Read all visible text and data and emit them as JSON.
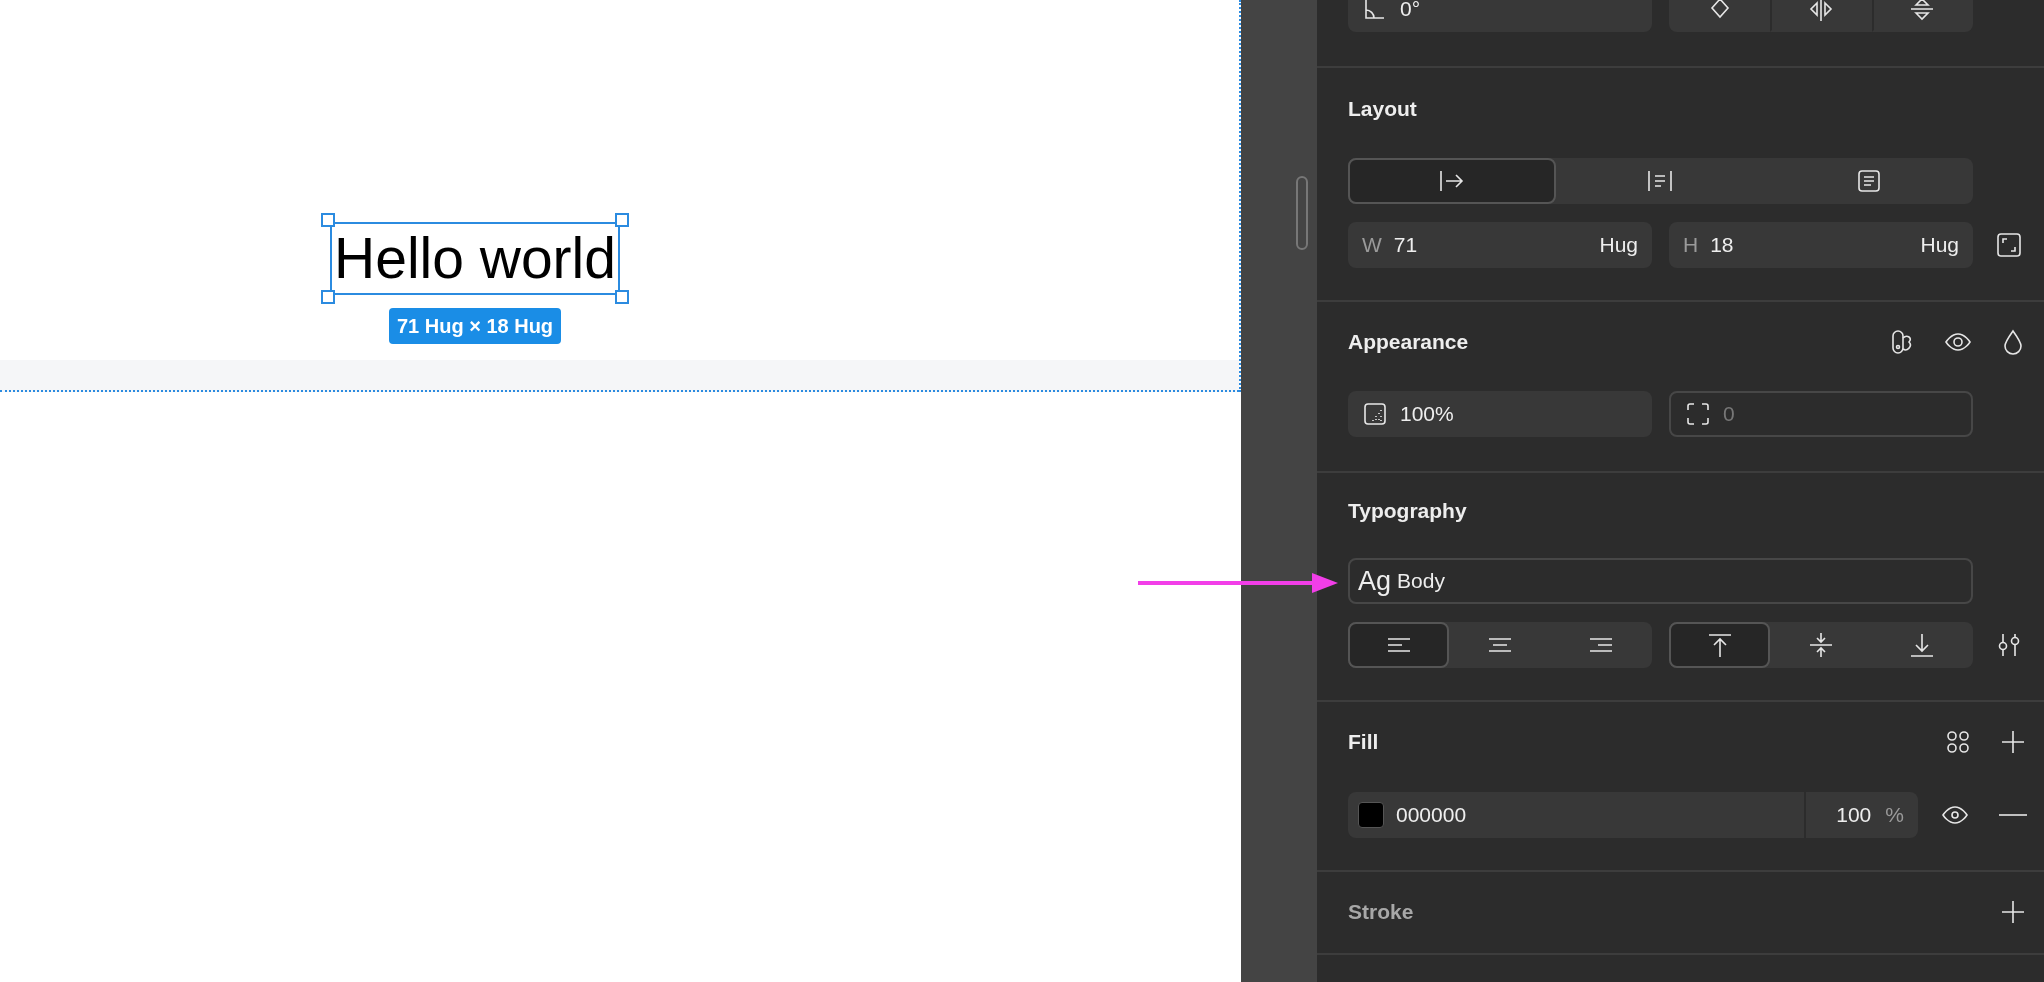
{
  "canvas": {
    "text": "Hello world",
    "size_label": "71 Hug × 18 Hug"
  },
  "transform": {
    "rotation": "0°"
  },
  "layout": {
    "title": "Layout",
    "resize_modes": [
      {
        "kind": "auto-width",
        "selected": true
      },
      {
        "kind": "auto-height",
        "selected": false
      },
      {
        "kind": "fixed",
        "selected": false
      }
    ],
    "width": {
      "label": "W",
      "value": "71",
      "mode": "Hug"
    },
    "height": {
      "label": "H",
      "value": "18",
      "mode": "Hug"
    }
  },
  "appearance": {
    "title": "Appearance",
    "opacity": "100%",
    "radius": {
      "value": "0"
    }
  },
  "typography": {
    "title": "Typography",
    "style": {
      "sample": "Ag",
      "name": "Body"
    },
    "horizontal_align": [
      {
        "kind": "left",
        "selected": true
      },
      {
        "kind": "center",
        "selected": false
      },
      {
        "kind": "right",
        "selected": false
      }
    ],
    "vertical_align": [
      {
        "kind": "top",
        "selected": true
      },
      {
        "kind": "middle",
        "selected": false
      },
      {
        "kind": "bottom",
        "selected": false
      }
    ]
  },
  "fill": {
    "title": "Fill",
    "fills": [
      {
        "color": "#000000",
        "hex": "000000",
        "opacity": "100",
        "unit": "%"
      }
    ]
  },
  "stroke": {
    "title": "Stroke",
    "active": false
  }
}
